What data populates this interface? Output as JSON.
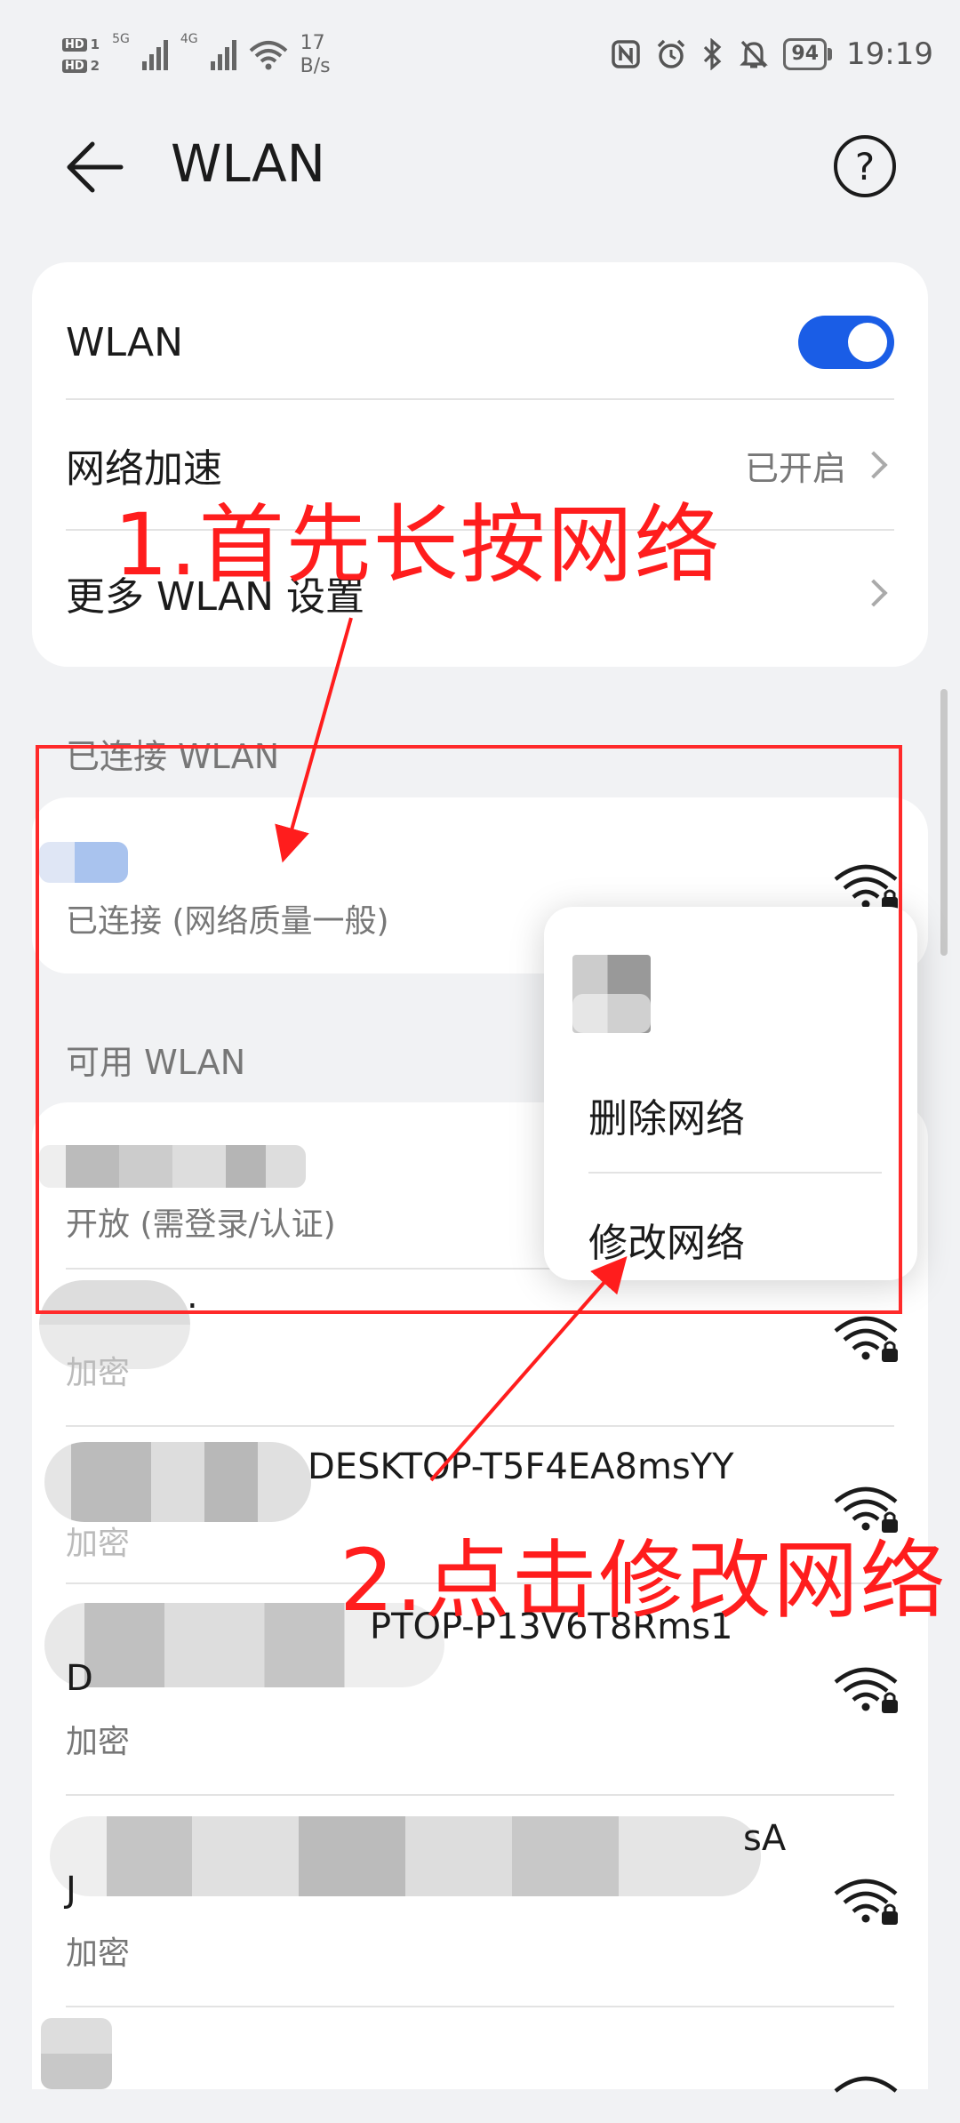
{
  "status_bar": {
    "sim1": "HD",
    "sim1_num": "1",
    "sim2": "HD",
    "sim2_num": "2",
    "net1": "5G",
    "net2": "4G",
    "speed_value": "17",
    "speed_unit": "B/s",
    "battery": "94",
    "time": "19:19"
  },
  "header": {
    "title": "WLAN"
  },
  "settings": {
    "wlan_label": "WLAN",
    "wlan_on": true,
    "accel_label": "网络加速",
    "accel_value": "已开启",
    "more_label": "更多 WLAN 设置"
  },
  "connected_section": {
    "title": "已连接 WLAN",
    "status": "已连接 (网络质量一般)"
  },
  "available_section": {
    "title": "可用 WLAN",
    "networks": [
      {
        "name": "",
        "status": "开放 (需登录/认证)"
      },
      {
        "name": ".",
        "status": "加密"
      },
      {
        "name": "DESKTOP-T5F4EA8msYY",
        "status": "加密"
      },
      {
        "name": "PTOP-P13V6T8Rms1",
        "name2": "D",
        "status": "加密"
      },
      {
        "name": "sA",
        "name2": "J",
        "status": "加密"
      }
    ]
  },
  "context_menu": {
    "delete_label": "删除网络",
    "modify_label": "修改网络"
  },
  "annotations": {
    "step1": "1.首先长按网络",
    "step2": "2.点击修改网络",
    "color": "#ff1d1d"
  },
  "colors": {
    "accent": "#1a5de6",
    "background": "#f1f2f4"
  }
}
